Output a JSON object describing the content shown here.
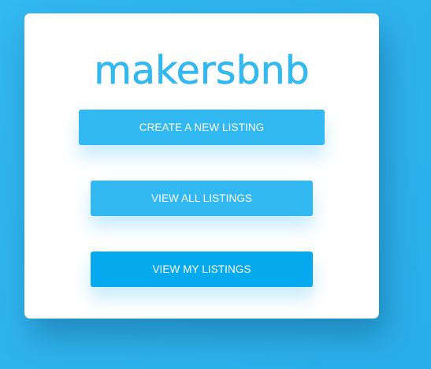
{
  "brand": {
    "logo_text": "makersbnb",
    "color": "#33b8f0"
  },
  "actions": {
    "create_label": "CREATE A NEW LISTING",
    "view_all_label": "VIEW ALL LISTINGS",
    "view_mine_label": "VIEW MY LISTINGS"
  },
  "colors": {
    "background": "#2eb4ef",
    "card": "#ffffff",
    "button": "#33b9f2",
    "button_active": "#05a9ee",
    "button_text": "#ffffff"
  }
}
